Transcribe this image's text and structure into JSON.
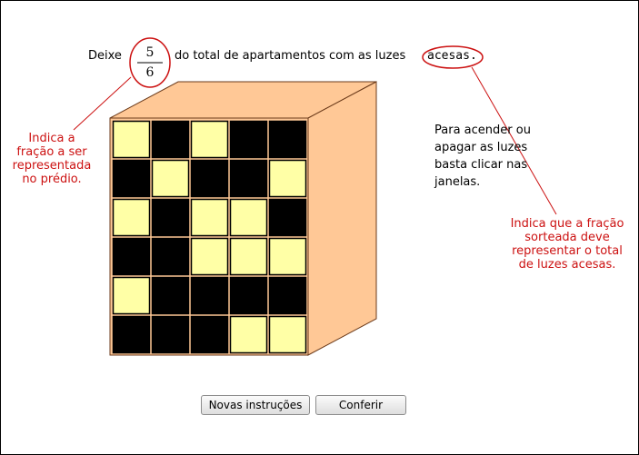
{
  "instruction": {
    "before": "Deixe",
    "fraction": {
      "numerator": "5",
      "denominator": "6"
    },
    "middle": "do total de apartamentos com as luzes",
    "keyword": "acesas."
  },
  "annotations": {
    "left": [
      "Indica a",
      "fração a ser",
      "representada",
      "no prédio."
    ],
    "right": [
      "Indica que a fração",
      "sorteada deve",
      "representar o total",
      "de luzes acesas."
    ]
  },
  "help_text": [
    "Para acender ou",
    "apagar as luzes",
    "basta clicar nas",
    "janelas."
  ],
  "building": {
    "rows": 6,
    "cols": 5,
    "windows_lit": [
      [
        true,
        false,
        true,
        false,
        false
      ],
      [
        false,
        true,
        false,
        false,
        true
      ],
      [
        true,
        false,
        true,
        true,
        false
      ],
      [
        false,
        false,
        true,
        true,
        true
      ],
      [
        true,
        false,
        false,
        false,
        false
      ],
      [
        false,
        false,
        false,
        true,
        true
      ]
    ],
    "colors": {
      "lit": "#ffffa6",
      "dark": "#000000",
      "wall": "#ffc896",
      "outline": "#6b3a1a"
    }
  },
  "buttons": {
    "new_instructions": "Novas instruções",
    "check": "Conferir"
  },
  "colors": {
    "annotation": "#cc1111"
  }
}
